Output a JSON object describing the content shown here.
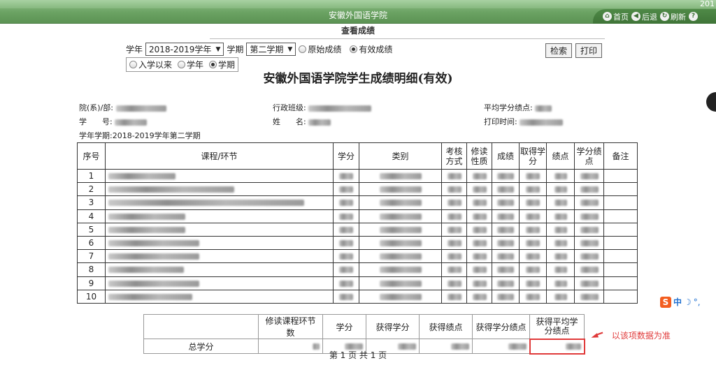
{
  "header": {
    "year_fragment": "201",
    "school_name": "安徽外国语学院",
    "nav": [
      {
        "label": "首页",
        "icon": "home-icon"
      },
      {
        "label": "后退",
        "icon": "back-icon"
      },
      {
        "label": "刷新",
        "icon": "refresh-icon"
      }
    ]
  },
  "page_title": "查看成绩",
  "filter": {
    "year_label": "学年",
    "year_value": "2018-2019学年",
    "term_label": "学期",
    "term_value": "第二学期",
    "options": [
      {
        "label": "原始成绩",
        "checked": false
      },
      {
        "label": "有效成绩",
        "checked": true
      }
    ],
    "scope": [
      {
        "label": "入学以来",
        "checked": false
      },
      {
        "label": "学年",
        "checked": false
      },
      {
        "label": "学期",
        "checked": true
      }
    ],
    "search_label": "检索",
    "print_label": "打印"
  },
  "report_title": "安徽外国语学院学生成绩明细(有效)",
  "info": {
    "dept_label": "院(系)/部:",
    "class_label": "行政班级:",
    "gpa_label": "平均学分绩点:",
    "id_label": "学　　号:",
    "name_label": "姓　　名:",
    "print_time_label": "打印时间:",
    "term_line": "学年学期:2018-2019学年第二学期"
  },
  "table": {
    "headers": [
      "序号",
      "课程/环节",
      "学分",
      "类别",
      "考核方式",
      "修读性质",
      "成绩",
      "取得学分",
      "绩点",
      "学分绩点",
      "备注"
    ],
    "rows": [
      "1",
      "2",
      "3",
      "4",
      "5",
      "6",
      "7",
      "8",
      "9",
      "10"
    ]
  },
  "summary": {
    "headers": [
      "修读课程环节数",
      "学分",
      "获得学分",
      "获得绩点",
      "获得学分绩点",
      "获得平均学分绩点"
    ],
    "row_label": "总学分"
  },
  "annotation": "以该项数据为准",
  "pager": "第 1 页  共 1 页",
  "ime": {
    "zh": "中"
  }
}
